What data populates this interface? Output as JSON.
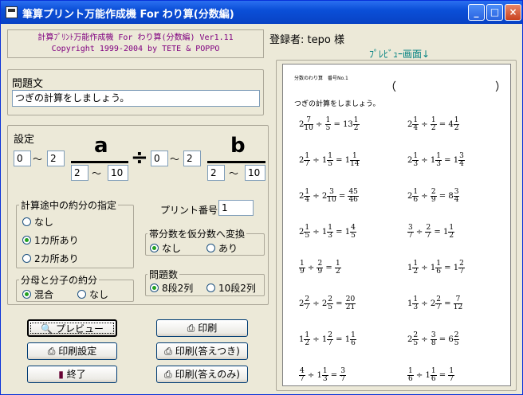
{
  "window": {
    "title": "筆算プリント万能作成機 For わり算(分数編)",
    "min": "_",
    "max": "□",
    "close": "×"
  },
  "header": {
    "line1": "計算ﾌﾟﾘﾝﾄ万能作成機 For わり算(分数編) Ver1.11",
    "line2": "Copyright 1999-2004 by TETE & POPPO",
    "registrant": "登録者: tepo 様",
    "preview_label": "ﾌﾟﾚﾋﾞｭｰ画面↓"
  },
  "question": {
    "label": "問題文",
    "text": "つぎの計算をしましょう。"
  },
  "settings": {
    "label": "設定",
    "a_label": "a",
    "b_label": "b",
    "div_sign": "÷",
    "tilde": "～",
    "a_whole_min": "0",
    "a_whole_max": "2",
    "a_den_min": "2",
    "a_den_max": "10",
    "b_whole_min": "0",
    "b_whole_max": "2",
    "b_den_min": "2",
    "b_den_max": "10"
  },
  "reduce_mid": {
    "label": "計算途中の約分の指定",
    "options": [
      "なし",
      "1カ所あり",
      "2カ所あり"
    ],
    "selected": 1
  },
  "print_number": {
    "label": "プリント番号",
    "value": "1"
  },
  "mixed_to_improper": {
    "label": "帯分数を仮分数へ変換",
    "options": [
      "なし",
      "あり"
    ],
    "selected": 0
  },
  "reduce_final": {
    "label": "分母と分子の約分",
    "options": [
      "混合",
      "なし"
    ],
    "selected": 0
  },
  "problem_count": {
    "label": "問題数",
    "options": [
      "8段2列",
      "10段2列"
    ],
    "selected": 0
  },
  "buttons": {
    "preview": "プレビュー",
    "print_settings": "印刷設定",
    "exit": "終了",
    "print": "印刷",
    "print_with_answers": "印刷(答えつき)",
    "print_answers_only": "印刷(答えのみ)"
  },
  "icons": {
    "preview": "magnifier-icon",
    "settings": "printer-settings-icon",
    "exit": "door-exit-icon",
    "print": "printer-icon"
  },
  "sheet": {
    "header_left": "分数のわり算",
    "header_mid": "番号No.1",
    "paren_open": "（",
    "paren_close": "）",
    "instruction": "つぎの計算をしましょう。",
    "problems": [
      {
        "a": [
          "2",
          "7",
          "10"
        ],
        "b": [
          "",
          "1",
          "5"
        ],
        "ans": [
          "13",
          "1",
          "2"
        ]
      },
      {
        "a": [
          "2",
          "1",
          "4"
        ],
        "b": [
          "",
          "1",
          "2"
        ],
        "ans": [
          "4",
          "1",
          "2"
        ]
      },
      {
        "a": [
          "2",
          "1",
          "7"
        ],
        "b": [
          "1",
          "1",
          "5"
        ],
        "ans": [
          "1",
          "1",
          "14"
        ]
      },
      {
        "a": [
          "2",
          "1",
          "3"
        ],
        "b": [
          "1",
          "1",
          "3"
        ],
        "ans": [
          "1",
          "3",
          "4"
        ]
      },
      {
        "a": [
          "2",
          "1",
          "4"
        ],
        "b": [
          "2",
          "3",
          "10"
        ],
        "ans": [
          "",
          "45",
          "46"
        ]
      },
      {
        "a": [
          "2",
          "1",
          "6"
        ],
        "b": [
          "",
          "2",
          "9"
        ],
        "ans": [
          "8",
          "3",
          "4"
        ]
      },
      {
        "a": [
          "2",
          "1",
          "5"
        ],
        "b": [
          "1",
          "1",
          "3"
        ],
        "ans": [
          "1",
          "4",
          "5"
        ]
      },
      {
        "a": [
          "",
          "3",
          "7"
        ],
        "b": [
          "",
          "2",
          "7"
        ],
        "ans": [
          "1",
          "1",
          "2"
        ]
      },
      {
        "a": [
          "",
          "1",
          "9"
        ],
        "b": [
          "",
          "2",
          "9"
        ],
        "ans": [
          "",
          "1",
          "2"
        ]
      },
      {
        "a": [
          "1",
          "1",
          "2"
        ],
        "b": [
          "1",
          "1",
          "6"
        ],
        "ans": [
          "1",
          "2",
          "7"
        ]
      },
      {
        "a": [
          "2",
          "2",
          "7"
        ],
        "b": [
          "2",
          "2",
          "5"
        ],
        "ans": [
          "",
          "20",
          "21"
        ]
      },
      {
        "a": [
          "1",
          "1",
          "3"
        ],
        "b": [
          "2",
          "2",
          "7"
        ],
        "ans": [
          "",
          "7",
          "12"
        ]
      },
      {
        "a": [
          "1",
          "1",
          "2"
        ],
        "b": [
          "1",
          "2",
          "7"
        ],
        "ans": [
          "1",
          "1",
          "6"
        ]
      },
      {
        "a": [
          "2",
          "2",
          "5"
        ],
        "b": [
          "",
          "3",
          "8"
        ],
        "ans": [
          "6",
          "2",
          "5"
        ]
      },
      {
        "a": [
          "",
          "4",
          "7"
        ],
        "b": [
          "1",
          "1",
          "3"
        ],
        "ans": [
          "",
          "3",
          "7"
        ]
      },
      {
        "a": [
          "",
          "1",
          "6"
        ],
        "b": [
          "1",
          "1",
          "6"
        ],
        "ans": [
          "",
          "1",
          "7"
        ]
      }
    ]
  }
}
